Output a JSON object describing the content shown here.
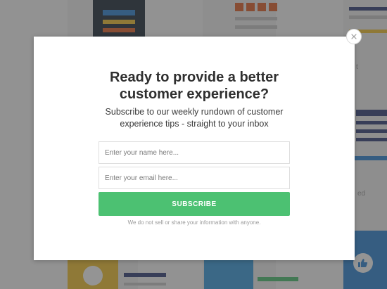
{
  "popup": {
    "title": "Ready to provide a better\ncustomer experience?",
    "subtitle": "Subscribe to our weekly rundown of customer\nexperience tips - straight to your inbox",
    "name_placeholder": "Enter your name here...",
    "email_placeholder": "Enter your email here...",
    "name_value": "",
    "email_value": "",
    "subscribe_label": "SUBSCRIBE",
    "disclaimer": "We do not sell or share your information with anyone.",
    "close_icon": "close-icon"
  },
  "background": {
    "side_text_1": "t",
    "side_text_2": "ed"
  },
  "colors": {
    "accent": "#4cc172",
    "overlay": "#3c3c3c",
    "bg_dark_tile": "#1f2d3a",
    "bg_orange": "#e2622b",
    "bg_yellow": "#f3c431",
    "bg_navy": "#33417a",
    "bg_blue": "#2f86d6"
  }
}
